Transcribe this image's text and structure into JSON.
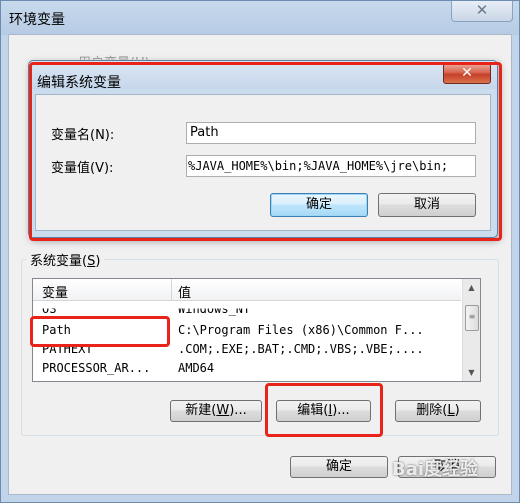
{
  "outer_window": {
    "title": "环境变量",
    "close_glyph": "✕",
    "user_vars_label": "用户变量(U)",
    "system_group": {
      "label_text": "系统变量(",
      "label_key": "S",
      "label_end": ")"
    },
    "table": {
      "headers": [
        "变量",
        "值"
      ],
      "rows": [
        {
          "name": "OS",
          "value": "Windows_NT"
        },
        {
          "name": "Path",
          "value": "C:\\Program Files (x86)\\Common F..."
        },
        {
          "name": "PATHEXT",
          "value": ".COM;.EXE;.BAT;.CMD;.VBS;.VBE;...."
        },
        {
          "name": "PROCESSOR_AR...",
          "value": "AMD64"
        }
      ]
    },
    "buttons": {
      "new": {
        "pre": "新建(",
        "key": "W",
        "post": ")..."
      },
      "edit": {
        "pre": "编辑(",
        "key": "I",
        "post": ")..."
      },
      "delete": {
        "pre": "删除(",
        "key": "L",
        "post": ")"
      },
      "ok": "确定",
      "cancel": "取消"
    }
  },
  "edit_dialog": {
    "title": "编辑系统变量",
    "close_glyph": "✕",
    "name_label": "变量名(N):",
    "name_value": "Path",
    "value_label": "变量值(V):",
    "value_value": "%JAVA_HOME%\\bin;%JAVA_HOME%\\jre\\bin;",
    "ok": "确定",
    "cancel": "取消"
  },
  "watermark": "Bai度经验",
  "colors": {
    "annotation_red": "#e8231a",
    "title_bar": "#c8d9ec"
  }
}
